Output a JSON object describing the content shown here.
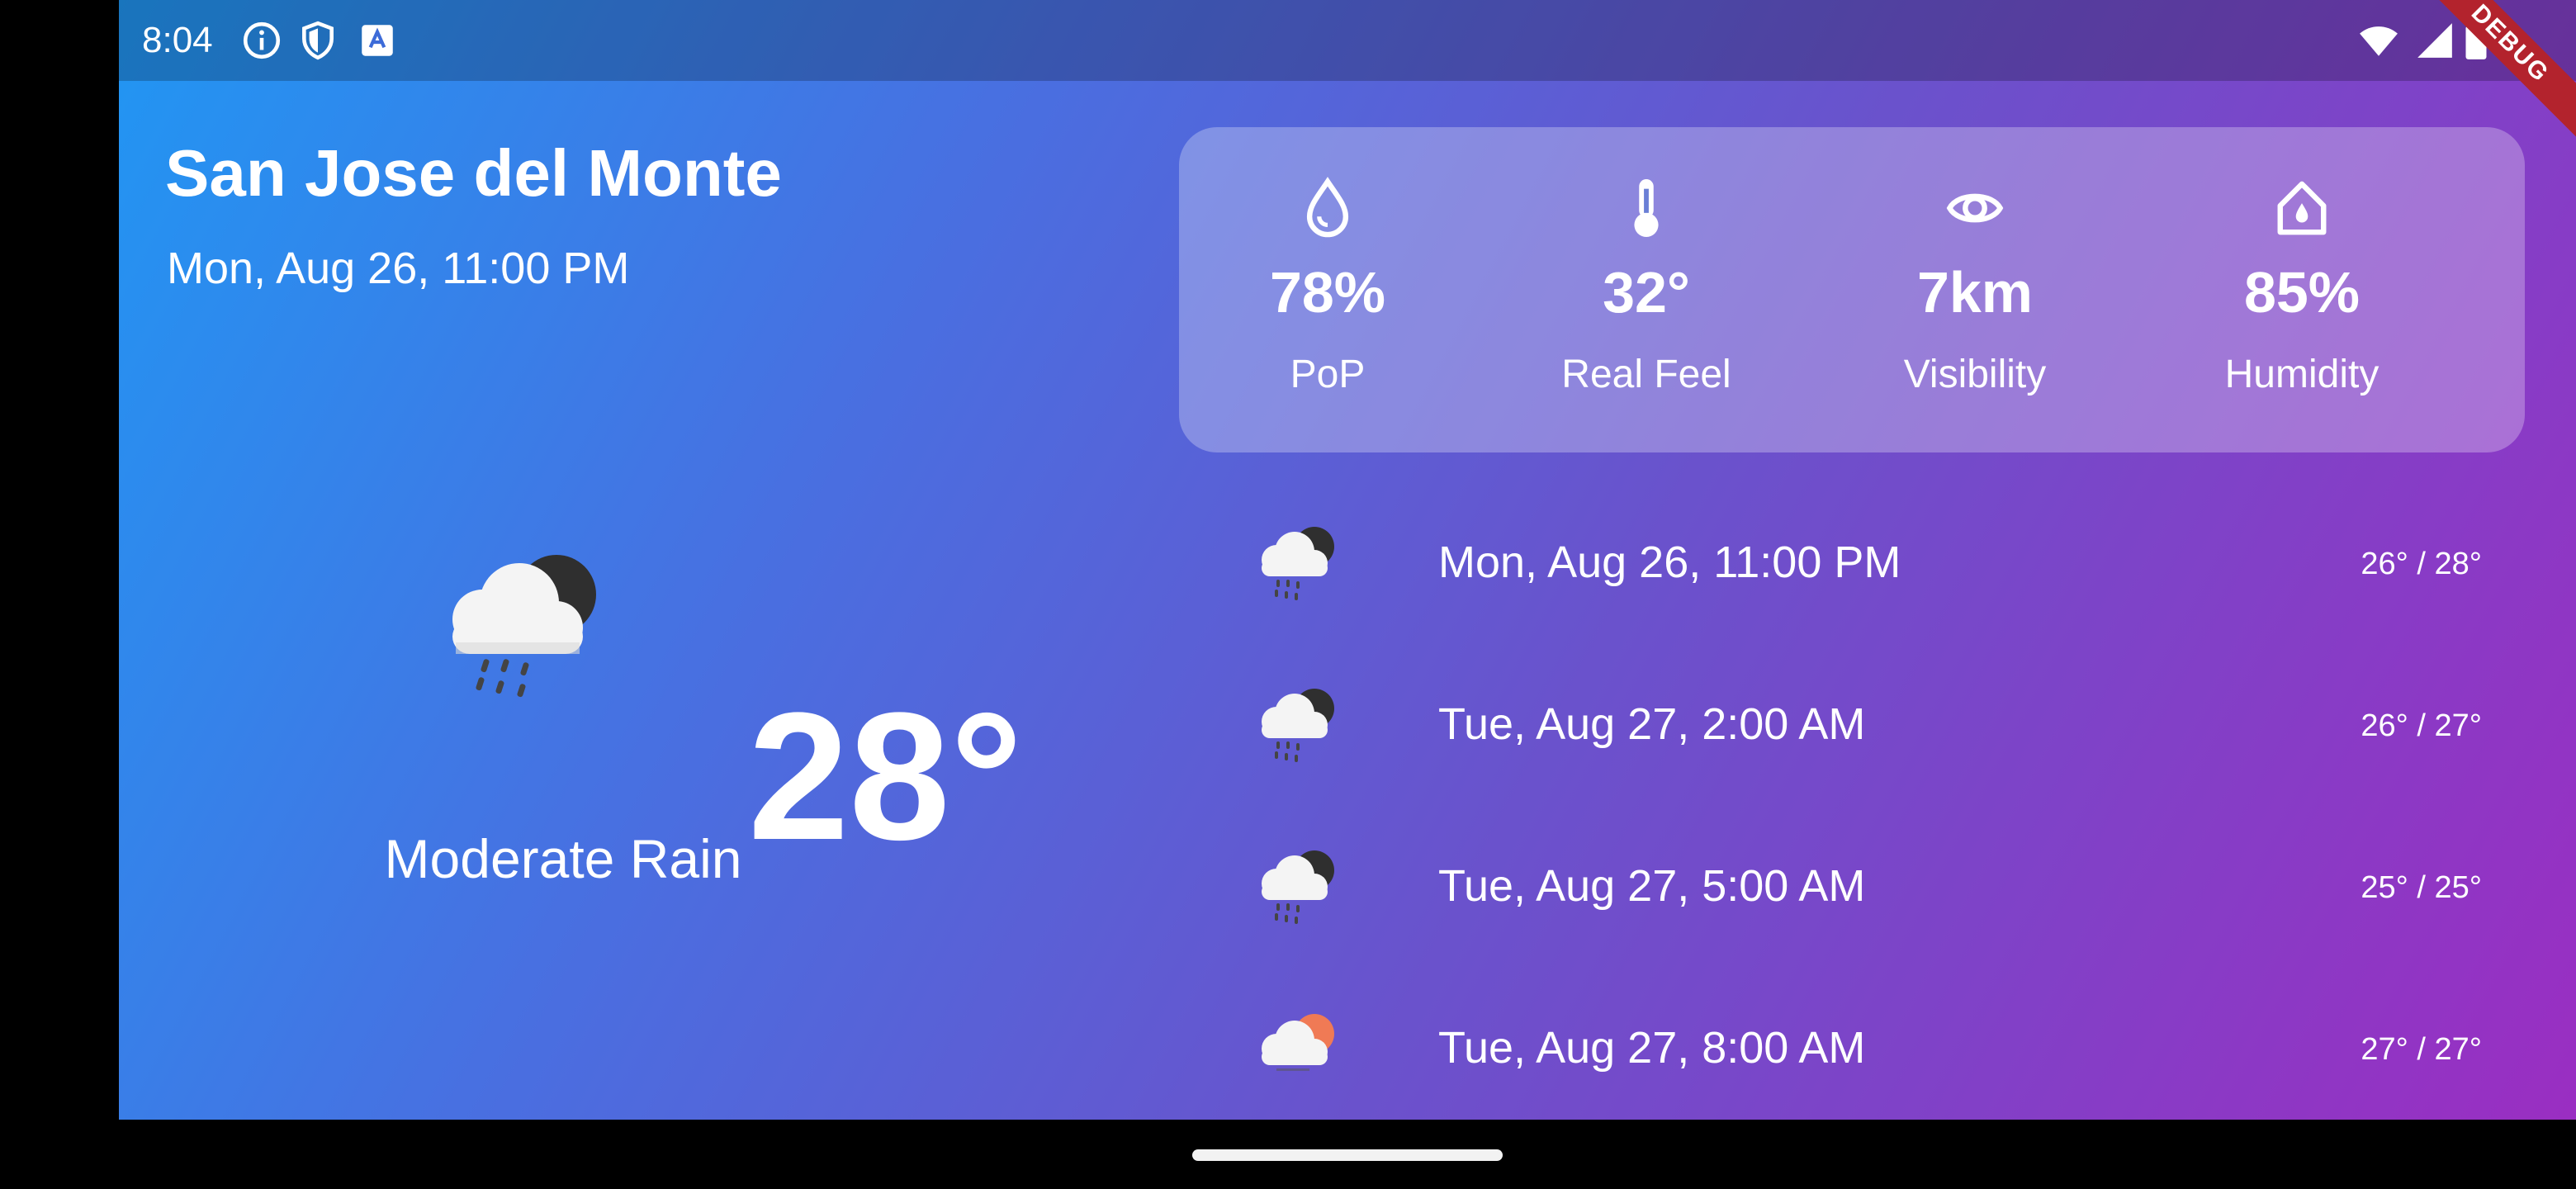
{
  "status_bar": {
    "time": "8:04",
    "icons": [
      "info-icon",
      "shield-icon",
      "keyboard-a-icon",
      "wifi-icon",
      "signal-icon",
      "battery-icon"
    ]
  },
  "debug_banner": "DEBUG",
  "header": {
    "city": "San Jose del Monte",
    "date": "Mon, Aug 26, 11:00 PM"
  },
  "current": {
    "icon": "rain-cloud-night-icon",
    "condition": "Moderate Rain",
    "temperature": "28°"
  },
  "details": [
    {
      "icon": "droplet-icon",
      "value": "78%",
      "label": "PoP"
    },
    {
      "icon": "thermometer-icon",
      "value": "32°",
      "label": "Real Feel"
    },
    {
      "icon": "eye-icon",
      "value": "7km",
      "label": "Visibility"
    },
    {
      "icon": "home-humidity-icon",
      "value": "85%",
      "label": "Humidity"
    }
  ],
  "forecast": [
    {
      "icon": "rain-cloud-night-icon",
      "date": "Mon, Aug 26, 11:00 PM",
      "range": "26° / 28°"
    },
    {
      "icon": "rain-cloud-night-icon",
      "date": "Tue, Aug 27, 2:00 AM",
      "range": "26° / 27°"
    },
    {
      "icon": "rain-cloud-night-icon",
      "date": "Tue, Aug 27, 5:00 AM",
      "range": "25° / 25°"
    },
    {
      "icon": "cloud-sun-icon",
      "date": "Tue, Aug 27, 8:00 AM",
      "range": "27° / 27°"
    }
  ],
  "colors": {
    "gradient_start": "#2196f3",
    "gradient_end": "#9a2ec2",
    "card_overlay": "rgba(255,255,255,0.28)",
    "debug_banner": "#b3232d",
    "sun": "#f07a55"
  }
}
